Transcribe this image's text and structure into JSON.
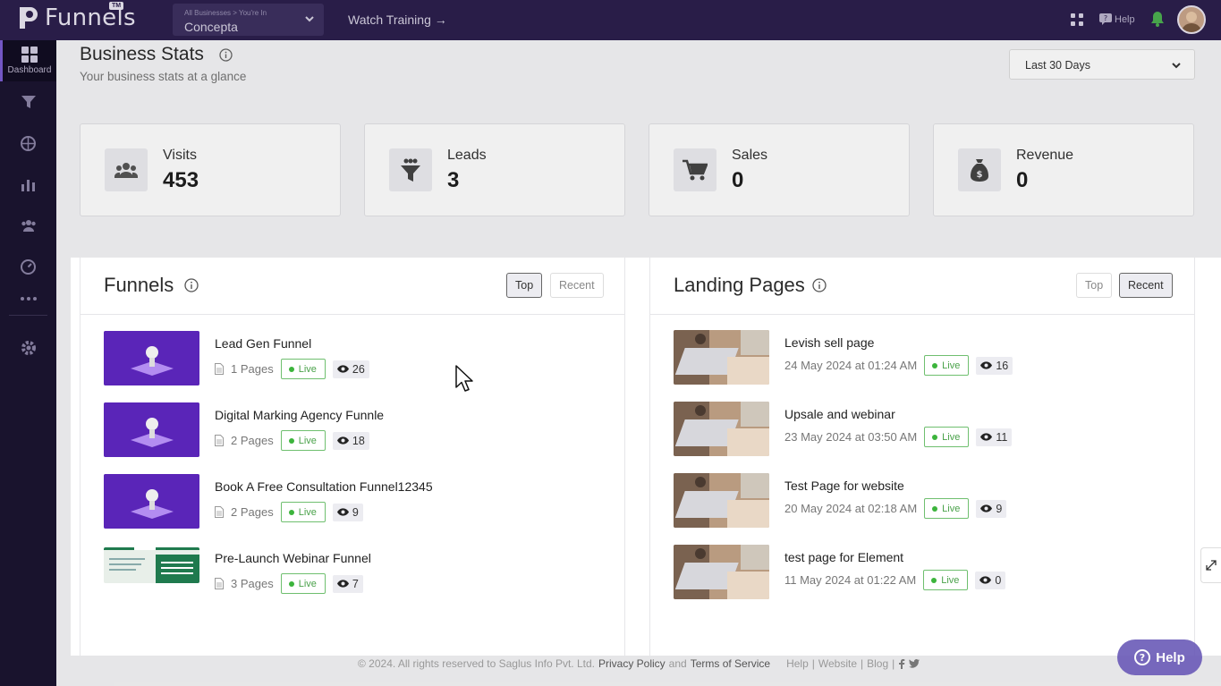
{
  "topbar": {
    "app_name": "Funnels",
    "badge": "TM",
    "business_hint": "All Businesses > You're In",
    "business_name": "Concepta",
    "watch_training": "Watch Training →",
    "help_label": "Help"
  },
  "sidebar": {
    "active_label": "Dashboard"
  },
  "header": {
    "title": "Business Stats",
    "subtitle": "Your business stats at a glance",
    "range": "Last 30 Days"
  },
  "stats": [
    {
      "label": "Visits",
      "value": "453"
    },
    {
      "label": "Leads",
      "value": "3"
    },
    {
      "label": "Sales",
      "value": "0"
    },
    {
      "label": "Revenue",
      "value": "0"
    }
  ],
  "funnels": {
    "title": "Funnels",
    "top_label": "Top",
    "recent_label": "Recent",
    "live_label": "Live",
    "items": [
      {
        "name": "Lead Gen Funnel",
        "pages": "1 Pages",
        "views": "26"
      },
      {
        "name": "Digital Marking Agency Funnle",
        "pages": "2 Pages",
        "views": "18"
      },
      {
        "name": "Book A Free Consultation Funnel12345",
        "pages": "2 Pages",
        "views": "9"
      },
      {
        "name": "Pre-Launch Webinar Funnel",
        "pages": "3 Pages",
        "views": "7"
      }
    ]
  },
  "landing": {
    "title": "Landing Pages",
    "top_label": "Top",
    "recent_label": "Recent",
    "live_label": "Live",
    "items": [
      {
        "name": "Levish sell page",
        "date": "24 May 2024 at 01:24 AM",
        "views": "16"
      },
      {
        "name": "Upsale and webinar",
        "date": "23 May 2024 at 03:50 AM",
        "views": "11"
      },
      {
        "name": "Test Page for website",
        "date": "20 May 2024 at 02:18 AM",
        "views": "9"
      },
      {
        "name": "test page for Element",
        "date": "11 May 2024 at 01:22 AM",
        "views": "0"
      }
    ]
  },
  "footer": {
    "copyright": "© 2024. All rights reserved to Saglus Info Pvt. Ltd.",
    "privacy": "Privacy Policy",
    "and": "and",
    "terms": "Terms of Service",
    "help": "Help",
    "website": "Website",
    "blog": "Blog",
    "sep": "|"
  },
  "help_fab": "Help",
  "colors": {
    "topbar": "#2c1f4d",
    "sidebar": "#1b1530",
    "live": "#4aa24a",
    "accent": "#6a5ab8"
  }
}
